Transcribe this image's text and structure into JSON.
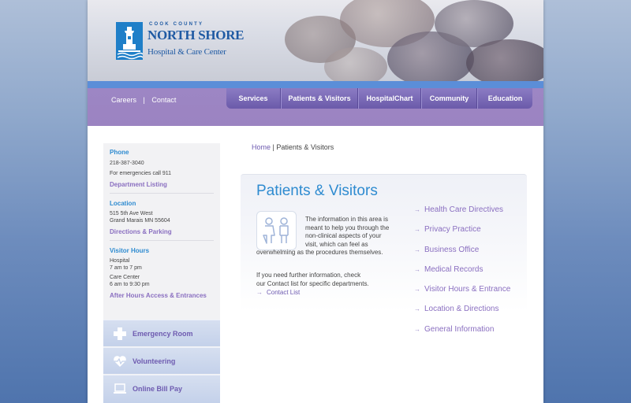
{
  "header": {
    "logo_top": "COOK COUNTY",
    "logo_main": "NORTH SHORE",
    "logo_sub": "Hospital & Care Center"
  },
  "util_links": [
    {
      "label": "Careers"
    },
    {
      "label": "Contact"
    }
  ],
  "util_separator": "|",
  "nav": [
    {
      "label": "Services"
    },
    {
      "label": "Patients & Visitors"
    },
    {
      "label": "HospitalChart"
    },
    {
      "label": "Community"
    },
    {
      "label": "Education"
    }
  ],
  "sidebar": {
    "phone": {
      "title": "Phone",
      "number": "218-387-3040",
      "emergency": "For emergencies call 911",
      "link": "Department Listing"
    },
    "location": {
      "title": "Location",
      "address1": "515 5th Ave West",
      "address2": "Grand Marais MN 55604",
      "link": "Directions & Parking"
    },
    "visitor_hours": {
      "title": "Visitor Hours",
      "hospital_label": "Hospital",
      "hospital_hours": "7 am to 7 pm",
      "care_label": "Care Center",
      "care_hours": "6 am to 9:30 pm",
      "link": "After Hours Access & Entrances"
    },
    "buttons": [
      {
        "label": "Emergency Room",
        "icon": "cross-icon"
      },
      {
        "label": "Volunteering",
        "icon": "heart-icon"
      },
      {
        "label": "Online Bill Pay",
        "icon": "laptop-icon"
      }
    ]
  },
  "breadcrumb": {
    "home": "Home",
    "separator": "|",
    "current": "Patients & Visitors"
  },
  "content": {
    "title": "Patients & Visitors",
    "intro": [
      "The information in this area is",
      "meant to help you through the",
      "non-clinical aspects of your",
      "visit, which can feel as",
      "overwhelming as the procedures themselves."
    ],
    "further": [
      "If you need further information, check",
      "our Contact list for specific departments."
    ],
    "contact_link": "Contact List",
    "arrow_glyph": "→",
    "links": [
      {
        "label": "Health Care Directives"
      },
      {
        "label": "Privacy Practice"
      },
      {
        "label": "Business Office"
      },
      {
        "label": "Medical Records"
      },
      {
        "label": "Visitor Hours & Entrance"
      },
      {
        "label": "Location & Directions"
      },
      {
        "label": "General Information"
      }
    ]
  },
  "colors": {
    "accent_blue": "#2e8bd0",
    "accent_purple": "#8a6fc0",
    "nav_purple": "#6b5aaa",
    "header_bar": "#5b8ed8"
  }
}
